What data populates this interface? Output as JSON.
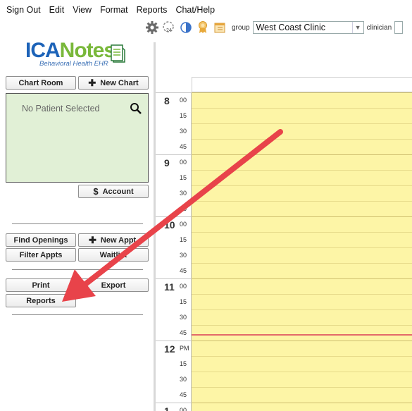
{
  "menu": {
    "items": [
      "Sign Out",
      "Edit",
      "View",
      "Format",
      "Reports",
      "Chat/Help"
    ]
  },
  "toolbar": {
    "icons": [
      "gear-icon",
      "clock-24-icon",
      "contrast-icon",
      "award-icon",
      "calendar-icon"
    ],
    "badge_24": "24",
    "group_label": "group",
    "group_value": "West Coast Clinic",
    "clinician_label": "clinician"
  },
  "logo": {
    "ica": "ICA",
    "notes": "Notes",
    "tagline": "Behavioral Health EHR"
  },
  "left": {
    "chart_room": "Chart Room",
    "new_chart": "New Chart",
    "no_patient": "No Patient Selected",
    "account": "Account",
    "find_openings": "Find Openings",
    "new_appt": "New Appt",
    "filter_appts": "Filter Appts",
    "waitlist": "Waitlist",
    "print": "Print",
    "export": "Export",
    "reports": "Reports"
  },
  "calendar": {
    "hours": [
      {
        "label": "8",
        "minutes": [
          "00",
          "15",
          "30",
          "45"
        ]
      },
      {
        "label": "9",
        "minutes": [
          "00",
          "15",
          "30",
          "45"
        ]
      },
      {
        "label": "10",
        "minutes": [
          "00",
          "15",
          "30",
          "45"
        ]
      },
      {
        "label": "11",
        "minutes": [
          "00",
          "15",
          "30",
          "45"
        ]
      },
      {
        "label": "12",
        "minutes": [
          "PM",
          "15",
          "30",
          "45"
        ]
      },
      {
        "label": "1",
        "minutes": [
          "00"
        ]
      }
    ]
  },
  "colors": {
    "accent_arrow": "#e8434a",
    "grid_yellow": "#fdf5a6",
    "patient_box": "#e1f0d6",
    "now_line": "#e36a6a"
  }
}
